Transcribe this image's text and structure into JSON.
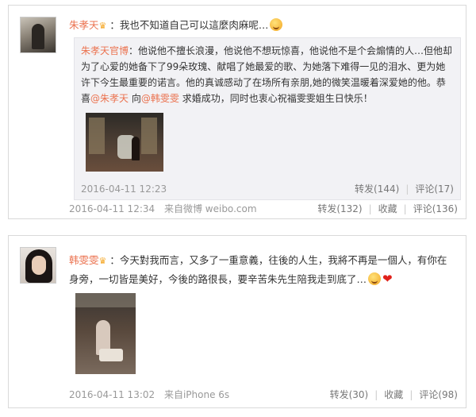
{
  "post1": {
    "username": "朱孝天",
    "text": "：我也不知道自己可以這麼肉麻呢…",
    "repost": {
      "username": "朱孝天官博",
      "text": "：他说他不擅长浪漫，他说他不想玩惊喜，他说他不是个会煽情的人…但他却为了心爱的她备下了99朵玫瑰、献唱了她最爱的歌、为她落下难得一见的泪水、更为她许下今生最重要的诺言。他的真诚感动了在场所有亲朋,她的微笑温暖着深爱她的他。恭喜",
      "mention1": "@朱孝天",
      "mid": " 向",
      "mention2": "@韩雯雯",
      "tail": " 求婚成功，同时也衷心祝福雯雯姐生日快乐！",
      "timestamp": "2016-04-11 12:23",
      "forward": "转发(144)",
      "comment": "评论(17)"
    },
    "timestamp": "2016-04-11 12:34",
    "source": "来自微博 weibo.com",
    "forward": "转发(132)",
    "favorite": "收藏",
    "comment": "评论(136)"
  },
  "post2": {
    "username": "韩雯雯",
    "text": "：今天對我而言，又多了一重意義，往後的人生，我將不再是一個人，有你在身旁，一切皆是美好，今後的路很長，要辛苦朱先生陪我走到底了…",
    "timestamp": "2016-04-11 13:02",
    "source": "来自iPhone 6s",
    "forward": "转发(30)",
    "favorite": "收藏",
    "comment": "评论(98)"
  },
  "icons": {
    "vip": "crown-icon",
    "emoji": "blush-emoji-icon",
    "heart": "heart-icon"
  }
}
